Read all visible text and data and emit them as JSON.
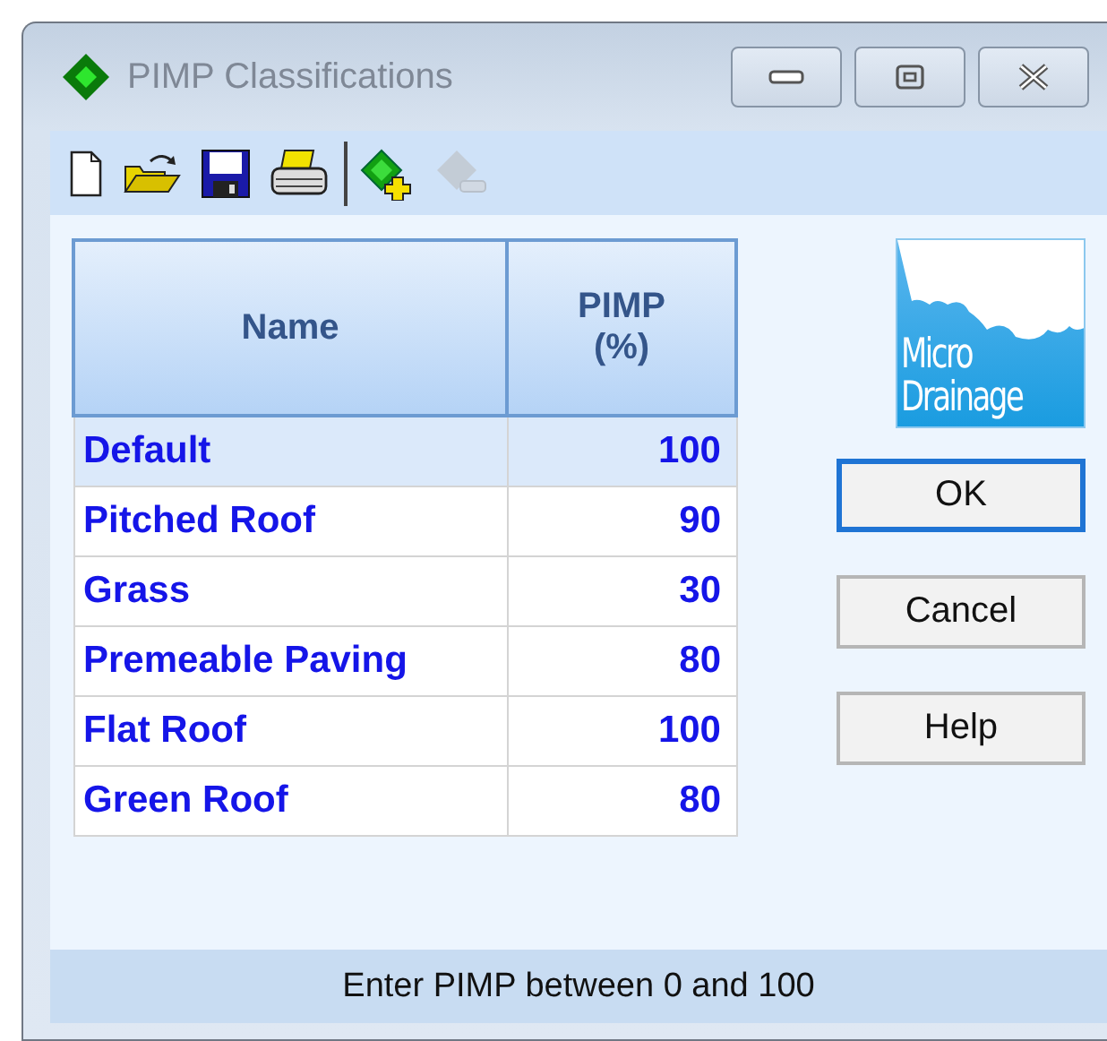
{
  "window": {
    "title": "PIMP Classifications",
    "controls": [
      {
        "kind": "minimize"
      },
      {
        "kind": "maximize"
      },
      {
        "kind": "close"
      }
    ]
  },
  "toolbar": {
    "groups": [
      [
        {
          "kind": "new",
          "disabled": false
        },
        {
          "kind": "open",
          "disabled": false
        },
        {
          "kind": "save",
          "disabled": false
        },
        {
          "kind": "print",
          "disabled": false
        }
      ],
      [
        {
          "kind": "add",
          "disabled": false
        },
        {
          "kind": "remove",
          "disabled": true
        }
      ]
    ]
  },
  "table": {
    "columns": [
      "Name",
      "PIMP (%)"
    ],
    "rows": [
      {
        "name": "Default",
        "pimp": "100",
        "selected": true
      },
      {
        "name": "Pitched Roof",
        "pimp": "90",
        "selected": false
      },
      {
        "name": "Grass",
        "pimp": "30",
        "selected": false
      },
      {
        "name": "Premeable Paving",
        "pimp": "80",
        "selected": false
      },
      {
        "name": "Flat Roof",
        "pimp": "100",
        "selected": false
      },
      {
        "name": "Green Roof",
        "pimp": "80",
        "selected": false
      }
    ]
  },
  "logo": {
    "lines": [
      "Micro",
      "Drainage"
    ]
  },
  "buttons": [
    {
      "label": "OK",
      "default": true
    },
    {
      "label": "Cancel",
      "default": false
    },
    {
      "label": "Help",
      "default": false
    }
  ],
  "status_bar": "Enter PIMP between 0 and 100"
}
